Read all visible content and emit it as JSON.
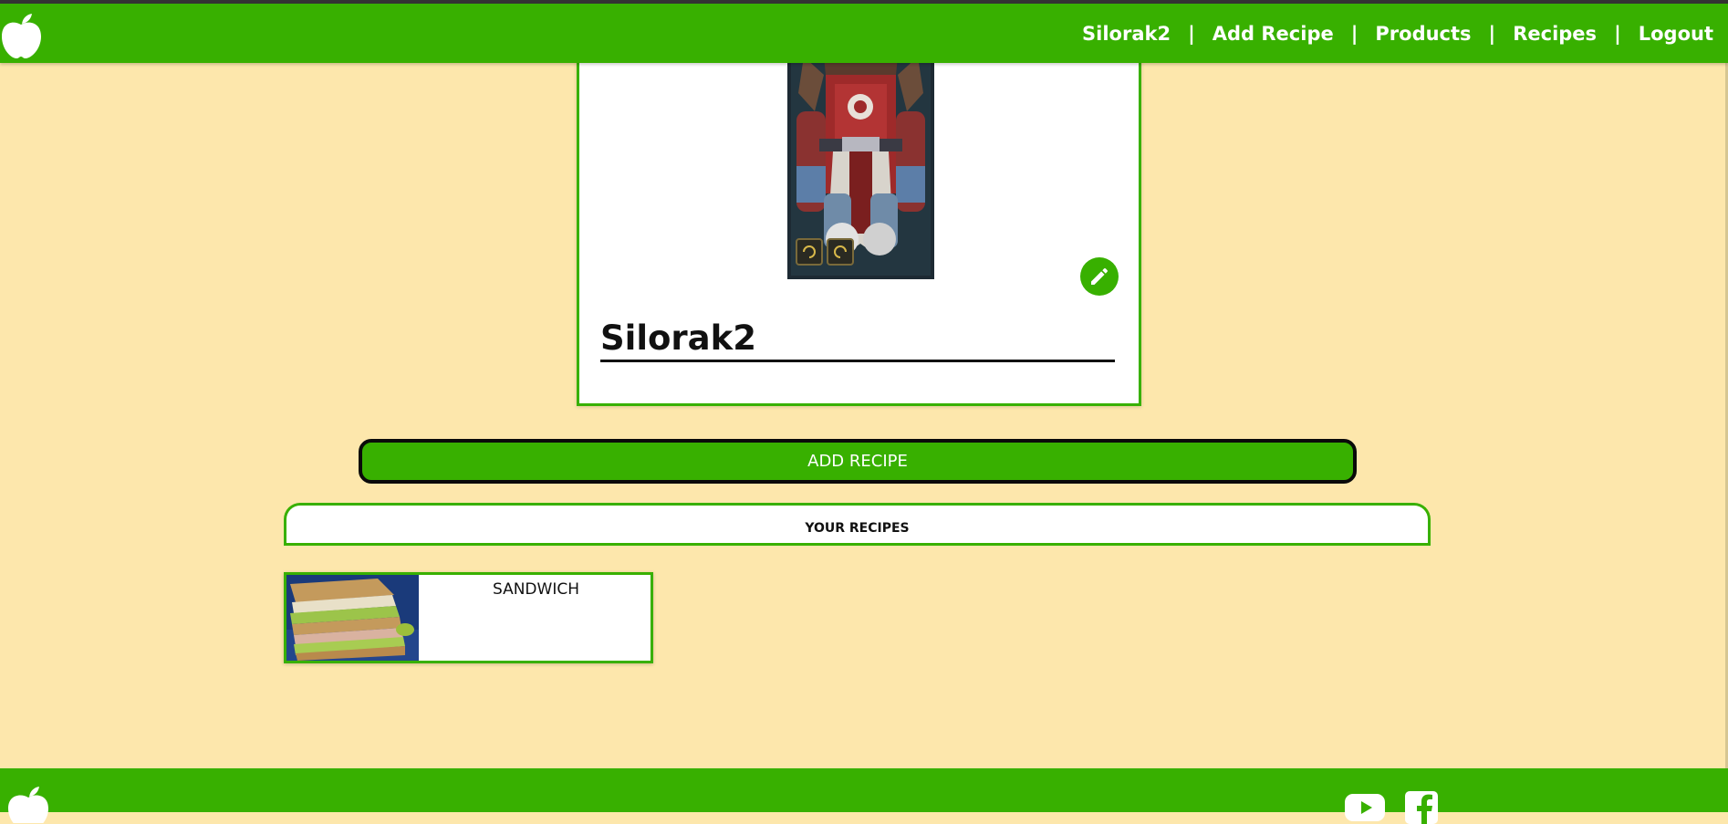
{
  "nav": {
    "username": "Silorak2",
    "add_recipe": "Add Recipe",
    "products": "Products",
    "recipes": "Recipes",
    "logout": "Logout",
    "separator": "|"
  },
  "profile": {
    "name": "Silorak2"
  },
  "actions": {
    "add_recipe_label": "ADD RECIPE"
  },
  "recipes_section": {
    "title": "YOUR RECIPES",
    "items": [
      {
        "title": "SANDWICH"
      }
    ]
  },
  "colors": {
    "brand_green": "#38b000",
    "page_background": "#fde7ac"
  },
  "icons": [
    "apple-logo-icon",
    "pencil-icon",
    "youtube-icon",
    "facebook-icon"
  ]
}
